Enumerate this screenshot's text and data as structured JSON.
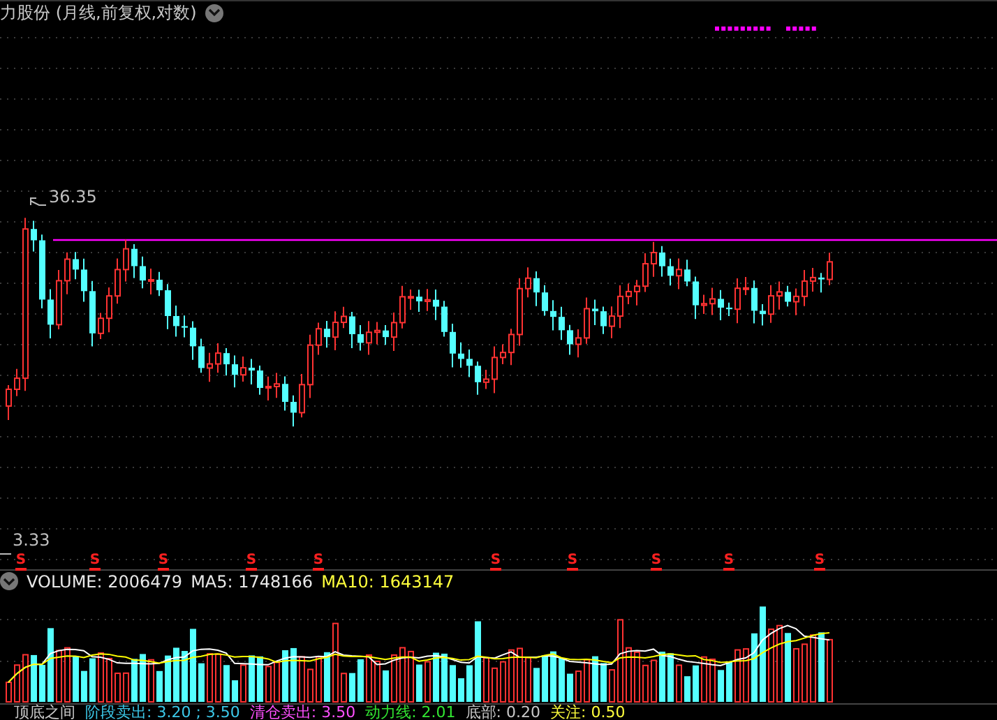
{
  "chart": {
    "title": "力股份 (月线,前复权,对数)",
    "high_label": "36.35",
    "low_label": "3.33",
    "signals": [
      "S",
      "S",
      "S",
      "S",
      "S",
      "S",
      "S",
      "S",
      "S",
      "S"
    ]
  },
  "volume_panel": {
    "items": [
      {
        "label": "VOLUME: 2006479",
        "color": "#e8e8e8"
      },
      {
        "label": "MA5: 1748166",
        "color": "#e8e8e8"
      },
      {
        "label": "MA10: 1643147",
        "color": "#ffff3c"
      }
    ]
  },
  "indicators": [
    {
      "label": "顶底之间",
      "color": "#c8c8c8"
    },
    {
      "label": "阶段卖出: 3.20 ; 3.50",
      "color": "#3cc8e8"
    },
    {
      "label": "清仓卖出: 3.50",
      "color": "#ff50ff"
    },
    {
      "label": "动力线: 2.01",
      "color": "#32e632"
    },
    {
      "label": "底部: 0.20",
      "color": "#c8c8c8"
    },
    {
      "label": "关注: 0.50",
      "color": "#ffff3c"
    }
  ]
}
